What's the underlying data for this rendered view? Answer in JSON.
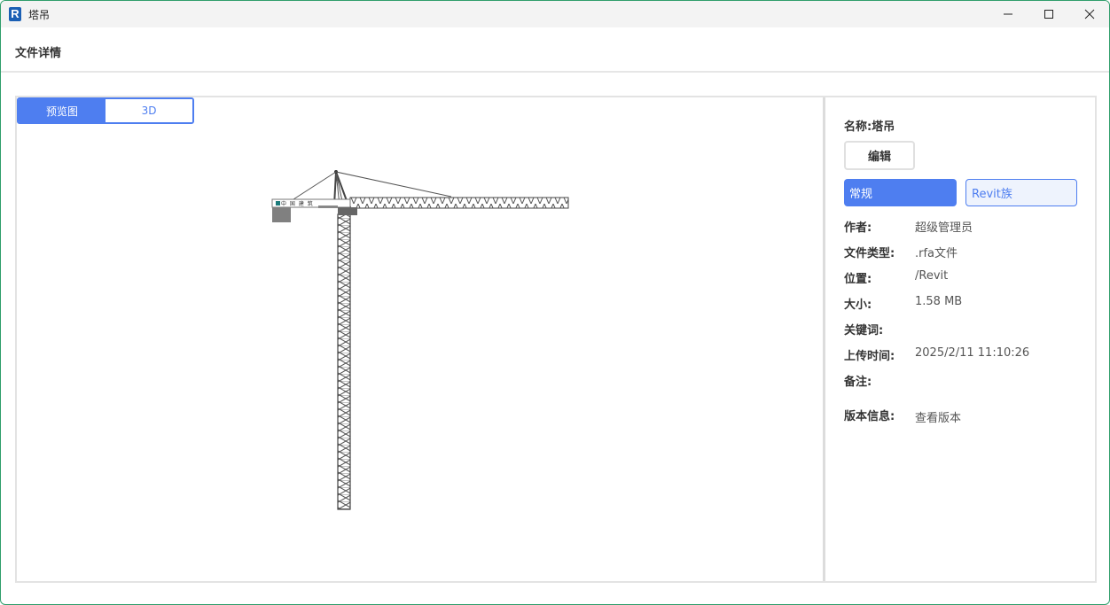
{
  "window": {
    "title": "塔吊",
    "app_icon_letter": "R",
    "accent_border": "#2f9e6b"
  },
  "header": {
    "title": "文件详情"
  },
  "preview": {
    "tabs": [
      {
        "label": "预览图",
        "active": true
      },
      {
        "label": "3D",
        "active": false
      }
    ],
    "image_description_icon": "tower-crane-image",
    "jib_sign_text": "中 国 建 筑"
  },
  "info": {
    "name_label": "名称:",
    "name_value": "塔吊",
    "edit_label": "编辑",
    "tabs": [
      {
        "label": "常规",
        "active": true
      },
      {
        "label": "Revit族",
        "active": false
      }
    ],
    "fields": [
      {
        "label": "作者:",
        "value": "超级管理员"
      },
      {
        "label": "文件类型:",
        "value": ".rfa文件"
      },
      {
        "label": "位置:",
        "value": "/Revit"
      },
      {
        "label": "大小:",
        "value": "1.58 MB"
      },
      {
        "label": "关键词:",
        "value": ""
      },
      {
        "label": "上传时间:",
        "value": "2025/2/11 11:10:26"
      },
      {
        "label": "备注:",
        "value": ""
      }
    ],
    "version": {
      "label": "版本信息:",
      "link": "查看版本"
    }
  },
  "colors": {
    "primary": "#4e7ef0",
    "tab_inactive_bg": "#eef3fd"
  }
}
